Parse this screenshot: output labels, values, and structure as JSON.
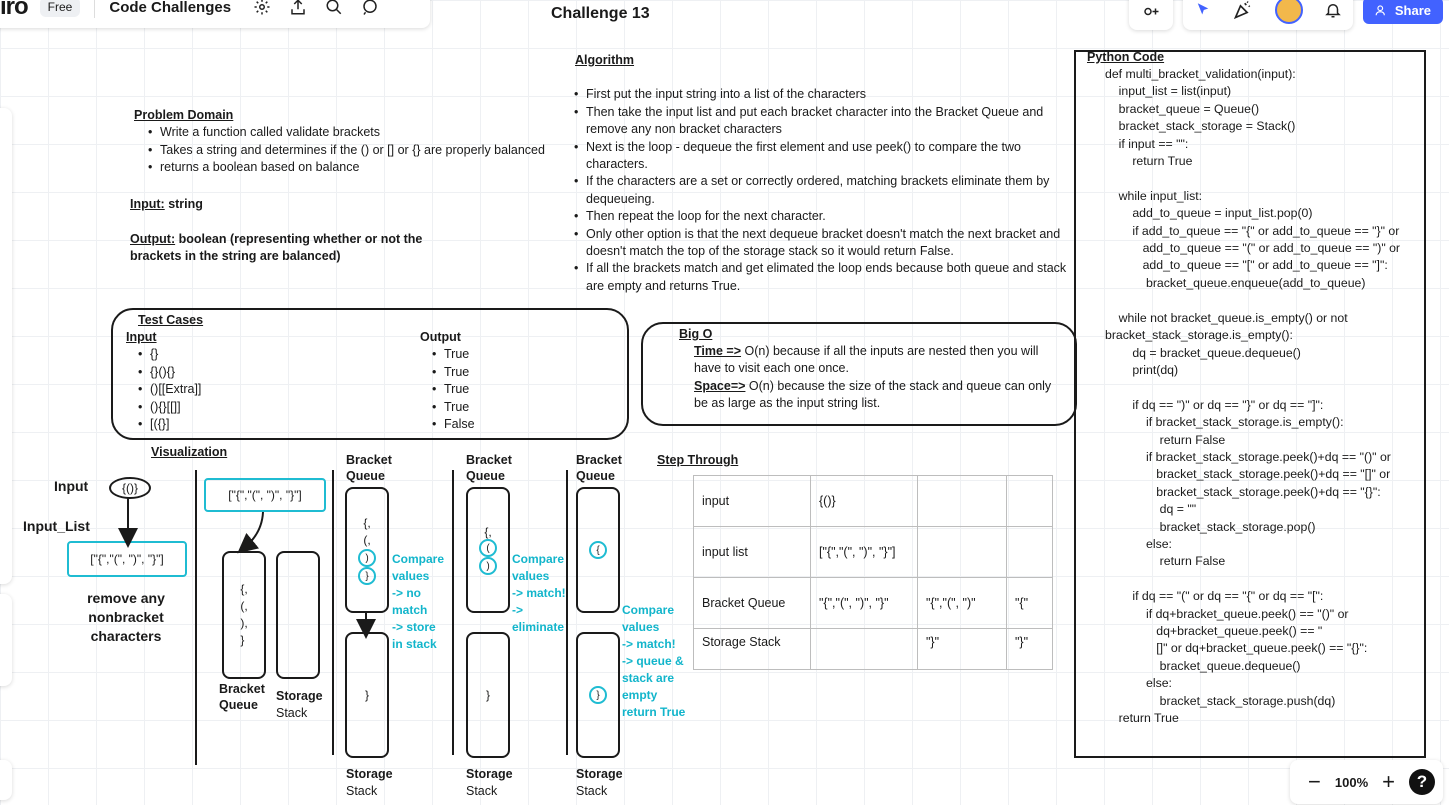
{
  "toolbar": {
    "logo": "iro",
    "plan_badge": "Free",
    "board_name": "Code Challenges",
    "share_label": "Share"
  },
  "zoom": {
    "level": "100%",
    "minus": "−",
    "plus": "+",
    "help": "?"
  },
  "board": {
    "title": "Challenge 13",
    "problem_domain": {
      "heading": "Problem Domain",
      "items": [
        "Write a function called validate brackets",
        "Takes a string and determines if the () or [] or {} are properly balanced",
        "returns a boolean based on balance"
      ],
      "input_label": "Input:",
      "input_value": " string",
      "output_label": "Output:",
      "output_value": "  boolean (representing whether or not the brackets in the string are balanced)"
    },
    "algorithm": {
      "heading": "Algorithm",
      "items": [
        "First put the input string into a list of the characters",
        "Then take the input list and put each bracket character into the Bracket Queue and remove any non bracket characters",
        "Next is the loop - dequeue the first element and use peek() to compare the two characters.",
        "If the characters are a set or correctly ordered, matching brackets eliminate them by dequeueing.",
        "Then repeat the loop for the next character.",
        "Only other option is that the next dequeue bracket doesn't match the next bracket and doesn't match the top of the storage stack so it would return False.",
        "If all the brackets match and get elimated the loop ends because both queue and stack are empty and returns True."
      ]
    },
    "test_cases": {
      "heading": "Test Cases",
      "input_heading": "Input",
      "output_heading": "Output",
      "inputs": [
        "{}",
        "{}(){}",
        "()[[Extra]]",
        "(){}[[]]",
        "[({}]"
      ],
      "outputs": [
        "True",
        "True",
        "True",
        "True",
        "False"
      ]
    },
    "big_o": {
      "heading": "Big O",
      "time_label": "Time =>",
      "time_text": " O(n) because if all the inputs are nested then you will have to visit each one once.",
      "space_label": "Space=>",
      "space_text": "  O(n) because the size of the stack and queue can only be as large as the input string list."
    },
    "visualization": {
      "heading": "Visualization",
      "input_label": "Input",
      "input_value": "{()}",
      "input_list_label": "Input_List",
      "input_list_value": "[\"{\",\"(\", \")\", \"}\"]",
      "list_copy": "[\"{\",\"(\", \")\", \"}\"]",
      "remove_note": "remove any nonbracket characters",
      "queue1": "{,\n(,\n),\n}",
      "bracket_label": "Bracket",
      "queue_label": "Queue",
      "storage_label": "Storage",
      "stack_label": "Stack",
      "step1_queue": "{,\n(,",
      "step1_circle_a": ")",
      "step1_circle_b": "}",
      "step1_stack": "}",
      "step1_note": "Compare\nvalues\n-> no\nmatch\n-> store\nin stack",
      "step2_queue": "{,",
      "step2_circle_a": "(",
      "step2_circle_b": ")",
      "step2_stack": "}",
      "step2_note": "Compare\nvalues\n-> match!\n->\neliminate",
      "step3_circle_q": "{",
      "step3_circle_s": "}",
      "step3_note": "Compare\nvalues\n-> match!\n-> queue &\nstack are\nempty\nreturn True"
    },
    "step_through": {
      "heading": "Step Through",
      "rows": [
        [
          "input",
          "{()}",
          "",
          ""
        ],
        [
          "input list",
          "[\"{\",\"(\", \")\", \"}\"]",
          "",
          ""
        ],
        [
          "Bracket Queue",
          "\"{\",\"(\", \")\", \"}\"",
          "\"{\",\"(\", \")\"",
          "\"{\""
        ],
        [
          "Storage Stack",
          "",
          "\"}\"",
          "\"}\""
        ]
      ]
    },
    "python": {
      "heading": "Python Code",
      "code": "def multi_bracket_validation(input):\n    input_list = list(input)\n    bracket_queue = Queue()\n    bracket_stack_storage = Stack()\n    if input == \"\":\n        return True\n\n    while input_list:\n        add_to_queue = input_list.pop(0)\n        if add_to_queue == \"{\" or add_to_queue == \"}\" or\n           add_to_queue == \"(\" or add_to_queue == \")\" or\n           add_to_queue == \"[\" or add_to_queue == \"]\":\n            bracket_queue.enqueue(add_to_queue)\n\n    while not bracket_queue.is_empty() or not\nbracket_stack_storage.is_empty():\n        dq = bracket_queue.dequeue()\n        print(dq)\n\n        if dq == \")\" or dq == \"}\" or dq == \"]\":\n            if bracket_stack_storage.is_empty():\n                return False\n            if bracket_stack_storage.peek()+dq == \"()\" or\n               bracket_stack_storage.peek()+dq == \"[]\" or\n               bracket_stack_storage.peek()+dq == \"{}\":\n                dq = \"\"\n                bracket_stack_storage.pop()\n            else:\n                return False\n\n        if dq == \"(\" or dq == \"{\" or dq == \"[\":\n            if dq+bracket_queue.peek() == \"()\" or\n               dq+bracket_queue.peek() == \"\n               []\" or dq+bracket_queue.peek() == \"{}\":\n                bracket_queue.dequeue()\n            else:\n                bracket_stack_storage.push(dq)\n    return True"
    }
  }
}
